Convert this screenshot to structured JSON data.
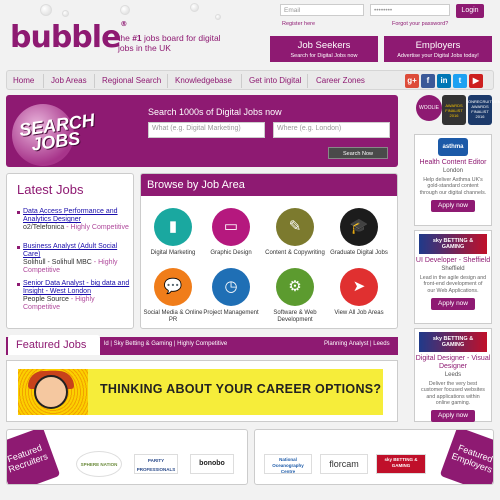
{
  "header": {
    "logo_text": "bubble",
    "logo_mark": "®",
    "tagline_prefix": "the ",
    "tagline_bold": "#1",
    "tagline_suffix": " jobs board for digital jobs in the UK",
    "login": {
      "email_placeholder": "Email",
      "password_placeholder": "••••••••",
      "login_button": "Login",
      "register_link": "Register here",
      "forgot_link": "Forgot your password?"
    },
    "job_seekers": {
      "title": "Job Seekers",
      "subtitle": "Search for Digital Jobs now"
    },
    "employers": {
      "title": "Employers",
      "subtitle": "Advertise your Digital Jobs today!"
    }
  },
  "nav": {
    "items": [
      "Home",
      "Job Areas",
      "Regional Search",
      "Knowledgebase",
      "Get into Digital",
      "Career Zones"
    ],
    "social": [
      {
        "icon": "google-plus-icon",
        "glyph": "g+",
        "color": "#dd4b39"
      },
      {
        "icon": "facebook-icon",
        "glyph": "f",
        "color": "#3b5998"
      },
      {
        "icon": "linkedin-icon",
        "glyph": "in",
        "color": "#0077b5"
      },
      {
        "icon": "twitter-icon",
        "glyph": "t",
        "color": "#1da1f2"
      },
      {
        "icon": "youtube-icon",
        "glyph": "▶",
        "color": "#cd201f"
      }
    ]
  },
  "search": {
    "banner_text_line1": "SEARCH",
    "banner_text_line2": "JOBS",
    "heading": "Search 1000s of Digital Jobs now",
    "keyword_placeholder": "What (e.g. Digital Marketing)",
    "location_placeholder": "Where (e.g. London)",
    "button": "Search Now"
  },
  "latest_jobs": {
    "heading": "Latest Jobs",
    "jobs": [
      {
        "title": "Data Access Performance and Analytics Designer",
        "company": "o2/Telefonica",
        "tag": " - Highly Competitive"
      },
      {
        "title": "Business Analyst (Adult Social Care)",
        "company": "Solihull - Solihull MBC",
        "tag": " - Highly Competitive"
      },
      {
        "title": "Senior Data Analyst - big data and Insight - West London",
        "company": "People Source",
        "tag": " - Highly Competitive"
      }
    ]
  },
  "browse": {
    "heading": "Browse by Job Area",
    "categories": [
      {
        "label": "Digital Marketing",
        "icon": "bar-chart-icon",
        "glyph": "▮",
        "color": "#1aa8a0"
      },
      {
        "label": "Graphic Design",
        "icon": "monitor-icon",
        "glyph": "▭",
        "color": "#b5187e"
      },
      {
        "label": "Content & Copywriting",
        "icon": "pencil-icon",
        "glyph": "✎",
        "color": "#7c7a2e"
      },
      {
        "label": "Graduate Digital Jobs",
        "icon": "graduation-cap-icon",
        "glyph": "🎓",
        "color": "#1c1c1c"
      },
      {
        "label": "Social Media & Online PR",
        "icon": "chat-bubble-icon",
        "glyph": "💬",
        "color": "#f07d1a"
      },
      {
        "label": "Project Management",
        "icon": "clock-icon",
        "glyph": "◷",
        "color": "#1f6fb5"
      },
      {
        "label": "Software & Web Development",
        "icon": "gear-icon",
        "glyph": "⚙",
        "color": "#5c9b2f"
      },
      {
        "label": "View All Job Areas",
        "icon": "mouse-cursor-icon",
        "glyph": "➤",
        "color": "#e03030"
      }
    ]
  },
  "featured_jobs": {
    "heading": "Featured Jobs",
    "ticker": "ld | Sky Betting & Gaming | Highly Competitive",
    "ticker_right": "Planning Analyst | Leeds",
    "ad_text": "THINKING ABOUT YOUR CAREER OPTIONS?"
  },
  "sidebar": {
    "award_badges": [
      "WOOLIE",
      "AWARDS FINALIST 2016",
      "ONRECRUITMENT AWARDS FINALIST 2016"
    ],
    "cards": [
      {
        "logo": "asthma",
        "logo_color": "#1c5aa8",
        "title": "Health Content Editor",
        "location": "London",
        "desc": "Help deliver Asthma UK's gold-standard content through our digital channels.",
        "apply": "Apply now"
      },
      {
        "logo": "sky BETTING & GAMING",
        "logo_color": "#1f3a8a",
        "title": "UI Developer - Sheffield",
        "location": "Sheffield",
        "desc": "Lead in the agile design and front-end development of our Web Applications.",
        "apply": "Apply now"
      },
      {
        "logo": "sky BETTING & GAMING",
        "logo_color": "#1f3a8a",
        "title": "Digital Designer - Visual Designer",
        "location": "Leeds",
        "desc": "Deliver the very best customer focused websites and applications within online gaming.",
        "apply": "Apply now"
      }
    ]
  },
  "featured_recruiters": {
    "label_line1": "Featured",
    "label_line2": "Recruiters",
    "logos": [
      {
        "name": "SPHERE NATION",
        "color": "#6a8a3a"
      },
      {
        "name": "PARITY PROFESSIONALS",
        "color": "#2a4a8a"
      },
      {
        "name": "bonobo",
        "color": "#222"
      }
    ]
  },
  "featured_employers": {
    "label_line1": "Featured",
    "label_line2": "Employers",
    "logos": [
      {
        "name": "National Oceanography Centre",
        "color": "#1c5aa8"
      },
      {
        "name": "florcam",
        "color": "#333"
      },
      {
        "name": "sky BETTING & GAMING",
        "color": "#c0102a"
      }
    ]
  }
}
